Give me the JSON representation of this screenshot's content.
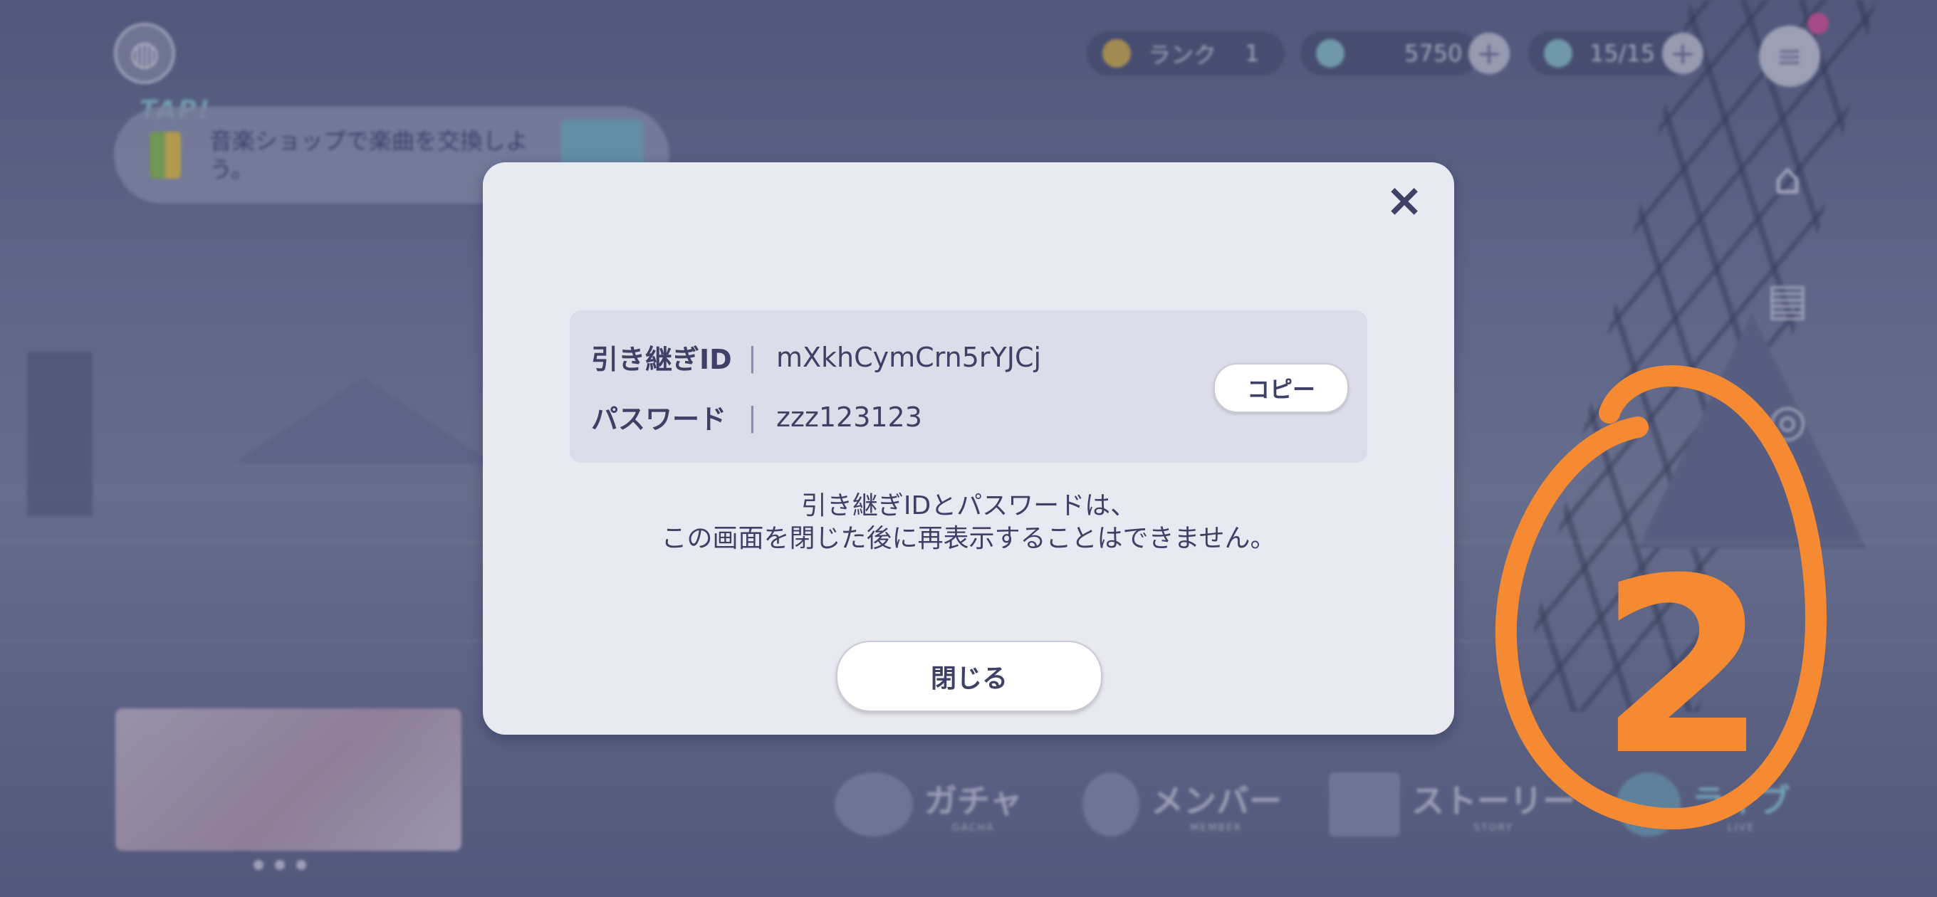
{
  "header": {
    "rank_label": "ランク",
    "rank_value": "1",
    "crystals": "5750",
    "stamina": "15/15"
  },
  "mission": {
    "tap_label": "TAP!",
    "text": "音楽ショップで楽曲を交換しよう。"
  },
  "bottom_nav": [
    {
      "label": "ガチャ",
      "sub": "GACHA"
    },
    {
      "label": "メンバー",
      "sub": "MEMBER"
    },
    {
      "label": "ストーリー",
      "sub": "STORY"
    },
    {
      "label": "ライブ",
      "sub": "LIVE"
    }
  ],
  "dialog": {
    "close_icon": "×",
    "id_label": "引き継ぎID",
    "id_value": "mXkhCymCrn5rYJCj",
    "password_label": "パスワード",
    "password_value": "zzz123123",
    "separator": "|",
    "copy_button": "コピー",
    "notice_line1": "引き継ぎIDとパスワードは、",
    "notice_line2": "この画面を閉じた後に再表示することはできません。",
    "close_button": "閉じる"
  },
  "annotation": {
    "text": "2",
    "color": "#f58a32"
  },
  "colors": {
    "dialog_bg": "#e9eaf1",
    "text_primary": "#3e4066",
    "accent_orange": "#f58a32"
  }
}
